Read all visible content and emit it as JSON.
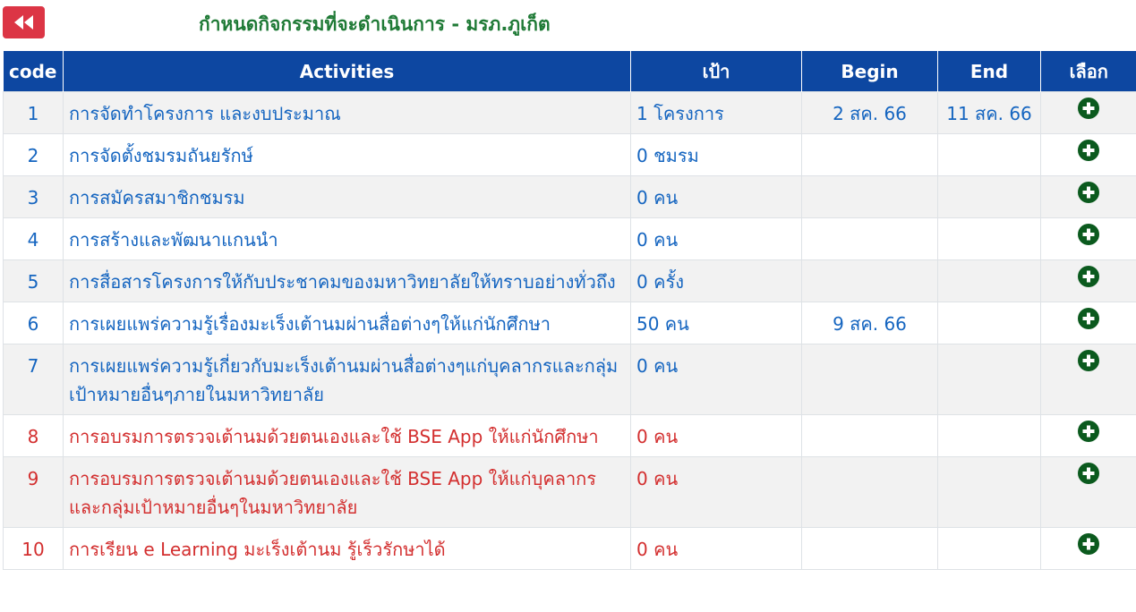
{
  "header": {
    "title": "กำหนดกิจกรรมที่จะดำเนินการ - มรภ.ภูเก็ต"
  },
  "table": {
    "columns": [
      "code",
      "Activities",
      "เป้า",
      "Begin",
      "End",
      "เลือก"
    ],
    "rows": [
      {
        "code": "1",
        "activity": "การจัดทำโครงการ และงบประมาณ",
        "target": "1 โครงการ",
        "begin": "2 สค. 66",
        "end": "11 สค. 66",
        "color": "#1565c0"
      },
      {
        "code": "2",
        "activity": "การจัดตั้งชมรมถันยรักษ์",
        "target": "0 ชมรม",
        "begin": "",
        "end": "",
        "color": "#1565c0"
      },
      {
        "code": "3",
        "activity": "การสมัครสมาชิกชมรม",
        "target": "0 คน",
        "begin": "",
        "end": "",
        "color": "#1565c0"
      },
      {
        "code": "4",
        "activity": "การสร้างและพัฒนาแกนนำ",
        "target": "0 คน",
        "begin": "",
        "end": "",
        "color": "#1565c0"
      },
      {
        "code": "5",
        "activity": "การสื่อสารโครงการให้กับประชาคมของมหาวิทยาลัยให้ทราบอย่างทั่วถึง",
        "target": "0 ครั้ง",
        "begin": "",
        "end": "",
        "color": "#1565c0"
      },
      {
        "code": "6",
        "activity": "การเผยแพร่ความรู้เรื่องมะเร็งเต้านมผ่านสื่อต่างๆให้แก่นักศึกษา",
        "target": "50 คน",
        "begin": "9 สค. 66",
        "end": "",
        "color": "#1565c0"
      },
      {
        "code": "7",
        "activity": "การเผยแพร่ความรู้เกี่ยวกับมะเร็งเต้านมผ่านสื่อต่างๆแก่บุคลากรและกลุ่มเป้าหมายอื่นๆภายในมหาวิทยาลัย",
        "target": "0 คน",
        "begin": "",
        "end": "",
        "color": "#1565c0"
      },
      {
        "code": "8",
        "activity": "การอบรมการตรวจเต้านมด้วยตนเองและใช้ BSE App ให้แก่นักศึกษา",
        "target": "0 คน",
        "begin": "",
        "end": "",
        "color": "#d32f2f"
      },
      {
        "code": "9",
        "activity": "การอบรมการตรวจเต้านมด้วยตนเองและใช้ BSE App ให้แก่บุคลากรและกลุ่มเป้าหมายอื่นๆในมหาวิทยาลัย",
        "target": "0 คน",
        "begin": "",
        "end": "",
        "color": "#d32f2f"
      },
      {
        "code": "10",
        "activity": "การเรียน e Learning มะเร็งเต้านม รู้เร็วรักษาได้",
        "target": "0 คน",
        "begin": "",
        "end": "",
        "color": "#d32f2f"
      }
    ]
  },
  "colors": {
    "header_bg": "#0d47a1",
    "title_green": "#1f7a36",
    "back_red": "#dc3545",
    "add_icon_green": "#0b5a1e",
    "row_blue": "#1565c0",
    "row_red": "#d32f2f"
  },
  "icons": {
    "back": "double-chevron-left-icon",
    "add": "plus-circle-icon"
  }
}
